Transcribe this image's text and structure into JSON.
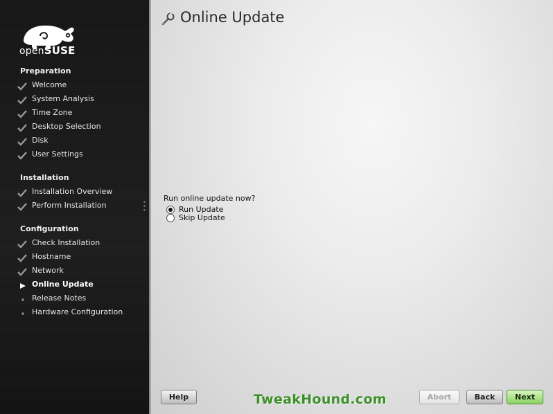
{
  "logo": {
    "text_light": "open",
    "text_bold": "SUSE"
  },
  "sidebar": {
    "sections": [
      {
        "title": "Preparation",
        "steps": [
          {
            "label": "Welcome",
            "state": "done"
          },
          {
            "label": "System Analysis",
            "state": "done"
          },
          {
            "label": "Time Zone",
            "state": "done"
          },
          {
            "label": "Desktop Selection",
            "state": "done"
          },
          {
            "label": "Disk",
            "state": "done"
          },
          {
            "label": "User Settings",
            "state": "done"
          }
        ]
      },
      {
        "title": "Installation",
        "steps": [
          {
            "label": "Installation Overview",
            "state": "done"
          },
          {
            "label": "Perform Installation",
            "state": "done"
          }
        ]
      },
      {
        "title": "Configuration",
        "steps": [
          {
            "label": "Check Installation",
            "state": "done"
          },
          {
            "label": "Hostname",
            "state": "done"
          },
          {
            "label": "Network",
            "state": "done"
          },
          {
            "label": "Online Update",
            "state": "current"
          },
          {
            "label": "Release Notes",
            "state": "pending"
          },
          {
            "label": "Hardware Configuration",
            "state": "pending"
          }
        ]
      }
    ]
  },
  "main": {
    "title": "Online Update",
    "title_icon": "update-wrench-icon",
    "question": "Run online update now?",
    "options": [
      {
        "label": "Run Update",
        "selected": true
      },
      {
        "label": "Skip Update",
        "selected": false
      }
    ]
  },
  "buttons": {
    "help": "Help",
    "abort": "Abort",
    "back": "Back",
    "next": "Next"
  },
  "watermark": "TweakHound.com",
  "colors": {
    "sidebar_bg": "#1a1a1a",
    "next_green": "#a8e083",
    "watermark_green": "#3d8f2a"
  }
}
